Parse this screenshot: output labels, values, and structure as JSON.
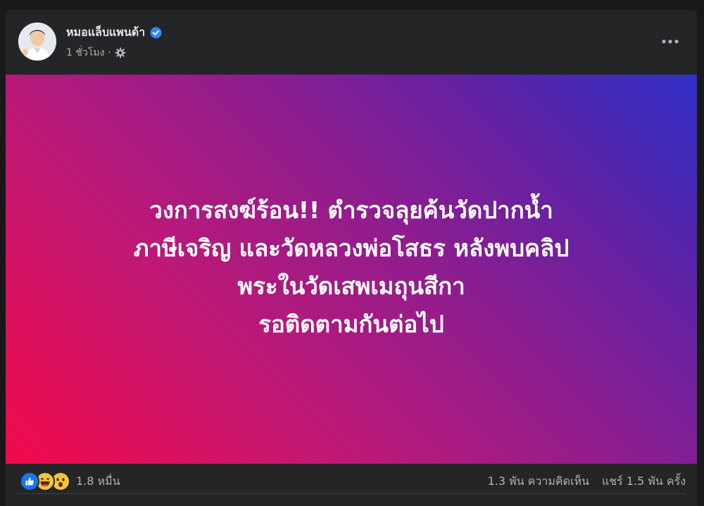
{
  "post": {
    "author": "หมอแล็บแพนด้า",
    "time": "1 ชั่วโมง",
    "separator": "·"
  },
  "icons": {
    "verified": "verified-badge-icon",
    "privacy": "gear-icon",
    "more": "more-options-icon",
    "reactions": [
      "like-icon",
      "haha-icon",
      "wow-icon"
    ]
  },
  "image_text": {
    "line1": "วงการสงฆ์ร้อน!! ตำรวจลุยค้นวัดปากน้ำ",
    "line2": "ภาษีเจริญ และวัดหลวงพ่อโสธร หลังพบคลิป",
    "line3": "พระในวัดเสพเมถุนสีกา",
    "line4": "รอติดตามกันต่อไป"
  },
  "engagement": {
    "reactions": "1.8 หมื่น",
    "comments": "1.3 พัน ความคิดเห็น",
    "shares": "แชร์ 1.5 พัน ครั้ง"
  },
  "colors": {
    "card_background": "#242526",
    "text_primary": "#e4e6eb",
    "text_secondary": "#b0b3b8",
    "verified_blue": "#2d88ff",
    "gradient_start": "#f3094a",
    "gradient_end": "#2f2fc8"
  }
}
